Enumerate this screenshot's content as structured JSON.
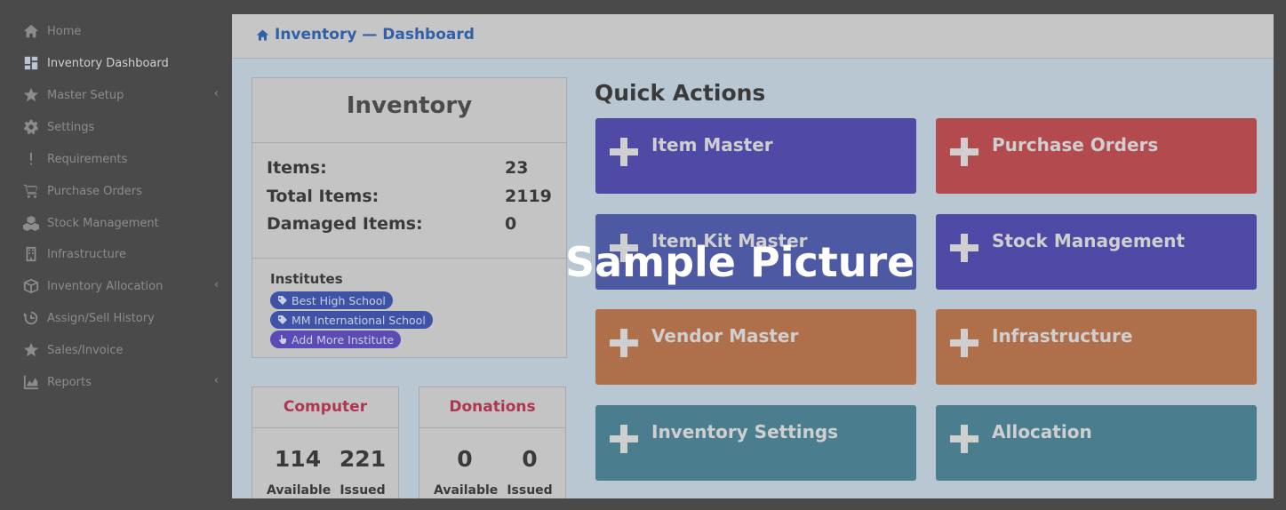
{
  "sidebar": {
    "items": [
      {
        "label": "Home",
        "icon": "home-icon"
      },
      {
        "label": "Inventory Dashboard",
        "icon": "dashboard-icon"
      },
      {
        "label": "Master Setup",
        "icon": "star-icon"
      },
      {
        "label": "Settings",
        "icon": "gear-icon"
      },
      {
        "label": "Requirements",
        "icon": "exclamation-icon"
      },
      {
        "label": "Purchase Orders",
        "icon": "cart-icon"
      },
      {
        "label": "Stock Management",
        "icon": "cubes-icon"
      },
      {
        "label": "Infrastructure",
        "icon": "building-icon"
      },
      {
        "label": "Inventory Allocation",
        "icon": "box-icon"
      },
      {
        "label": "Assign/Sell History",
        "icon": "history-icon"
      },
      {
        "label": "Sales/Invoice",
        "icon": "star-icon"
      },
      {
        "label": "Reports",
        "icon": "chart-icon"
      }
    ],
    "chevron": "‹"
  },
  "breadcrumb": {
    "text": "Inventory — Dashboard"
  },
  "inventory": {
    "title": "Inventory",
    "stats": [
      {
        "label": "Items:",
        "value": "23"
      },
      {
        "label": "Total Items:",
        "value": "2119"
      },
      {
        "label": "Damaged Items:",
        "value": "0"
      }
    ],
    "institutes_label": "Institutes",
    "institutes": [
      "Best High School",
      "MM International School"
    ],
    "add_more": "Add More Institute"
  },
  "mini_cards": [
    {
      "title": "Computer",
      "available": "114",
      "issued": "221",
      "available_label": "Available",
      "issued_label": "Issued"
    },
    {
      "title": "Donations",
      "available": "0",
      "issued": "0",
      "available_label": "Available",
      "issued_label": "Issued"
    }
  ],
  "quick_actions": {
    "title": "Quick Actions",
    "buttons": [
      {
        "label": "Item Master",
        "color": "#4e4aa6"
      },
      {
        "label": "Purchase Orders",
        "color": "#b24a4e"
      },
      {
        "label": "Item Kit Master",
        "color": "#4d5aa3"
      },
      {
        "label": "Stock Management",
        "color": "#4e4aa6"
      },
      {
        "label": "Vendor Master",
        "color": "#b06f4b"
      },
      {
        "label": "Infrastructure",
        "color": "#b06f4b"
      },
      {
        "label": "Inventory Settings",
        "color": "#4a7e8f"
      },
      {
        "label": "Allocation",
        "color": "#4a7e8f"
      }
    ]
  },
  "watermark": "Sample Picture"
}
